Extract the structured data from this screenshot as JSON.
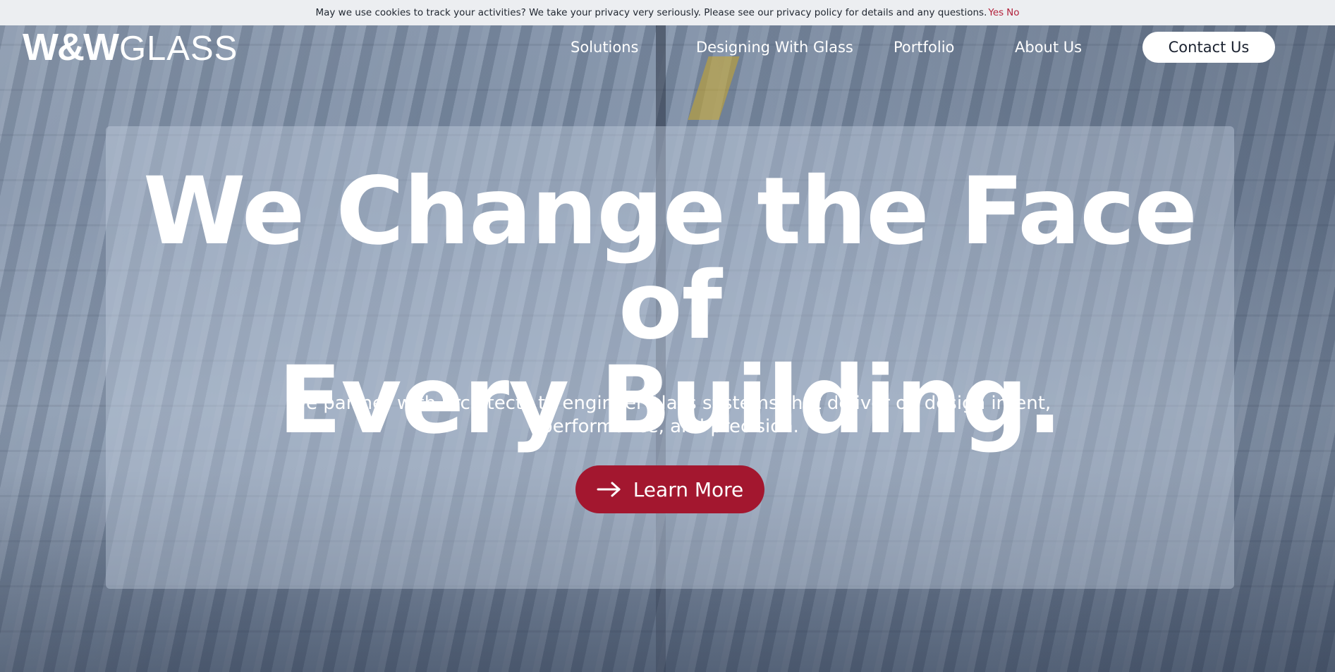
{
  "cookie_banner": {
    "message": "May we use cookies to track your activities? We take your privacy very seriously. Please see our privacy policy for details and any questions.",
    "yes_label": "Yes",
    "no_label": "No"
  },
  "header": {
    "logo_bold": "W&W",
    "logo_light": "GLASS",
    "nav": [
      {
        "label": "Solutions"
      },
      {
        "label": "Designing With Glass"
      },
      {
        "label": "Portfolio"
      },
      {
        "label": "About Us"
      }
    ],
    "contact_label": "Contact Us"
  },
  "hero": {
    "title_line1": "We Change the Face of",
    "title_line2": "Every Building.",
    "subtitle": "We partner with architects to engineer glass systems that deliver on design intent, performance, and precision.",
    "cta_label": "Learn More",
    "cta_icon": "arrow-right-icon"
  },
  "colors": {
    "accent": "#a3172f",
    "link": "#b3223c",
    "text_on_image": "#ffffff"
  }
}
